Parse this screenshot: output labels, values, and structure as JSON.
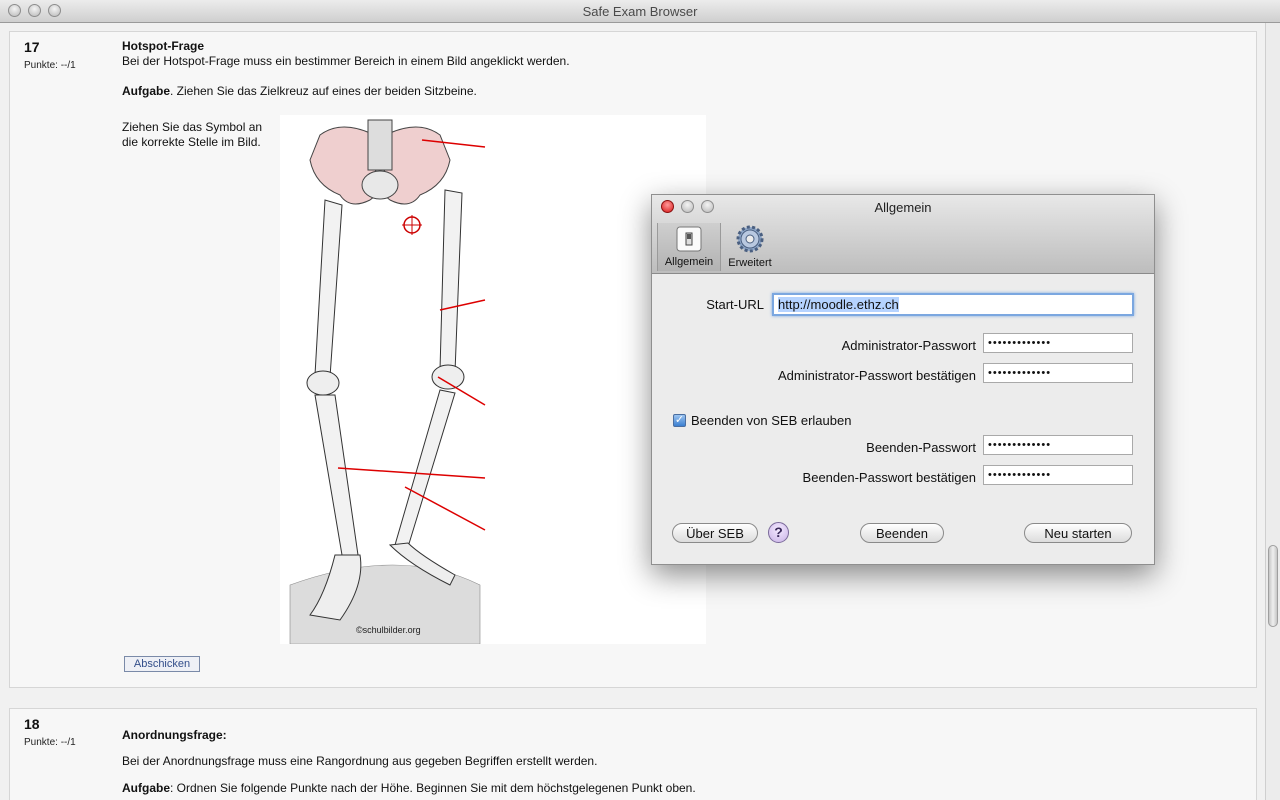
{
  "window": {
    "title": "Safe Exam Browser"
  },
  "question17": {
    "number": "17",
    "points": "Punkte: --/1",
    "title": "Hotspot-Frage",
    "description": "Bei der Hotspot-Frage muss ein bestimmer Bereich in einem Bild angeklickt werden.",
    "task_label": "Aufgabe",
    "task_text": ". Ziehen Sie das Zielkreuz auf eines der beiden Sitzbeine.",
    "instruction_line1": "Ziehen Sie das Symbol an",
    "instruction_line2": "die korrekte Stelle im Bild.",
    "image_credit": "©schulbilder.org",
    "submit_label": "Abschicken"
  },
  "question18": {
    "number": "18",
    "points": "Punkte: --/1",
    "title": "Anordnungsfrage:",
    "description": "Bei der Anordnungsfrage muss eine Rangordnung aus gegeben Begriffen erstellt werden.",
    "task_label": "Aufgabe",
    "task_text": ": Ordnen Sie folgende Punkte nach der Höhe. Beginnen Sie mit dem höchstgelegenen Punkt oben."
  },
  "dialog": {
    "title": "Allgemein",
    "tabs": [
      {
        "label": "Allgemein",
        "icon": "switch-icon",
        "selected": true
      },
      {
        "label": "Erweitert",
        "icon": "gear-icon",
        "selected": false
      }
    ],
    "start_url_label": "Start-URL",
    "start_url_value": "http://moodle.ethz.ch",
    "admin_pw_label": "Administrator-Passwort",
    "admin_pw_value": "•••••••••••••",
    "admin_pw_confirm_label": "Administrator-Passwort bestätigen",
    "admin_pw_confirm_value": "•••••••••••••",
    "allow_quit_label": "Beenden von SEB erlauben",
    "allow_quit_checked": true,
    "quit_pw_label": "Beenden-Passwort",
    "quit_pw_value": "•••••••••••••",
    "quit_pw_confirm_label": "Beenden-Passwort bestätigen",
    "quit_pw_confirm_value": "•••••••••••••",
    "about_button": "Über SEB",
    "help_button": "?",
    "quit_button": "Beenden",
    "restart_button": "Neu starten"
  }
}
